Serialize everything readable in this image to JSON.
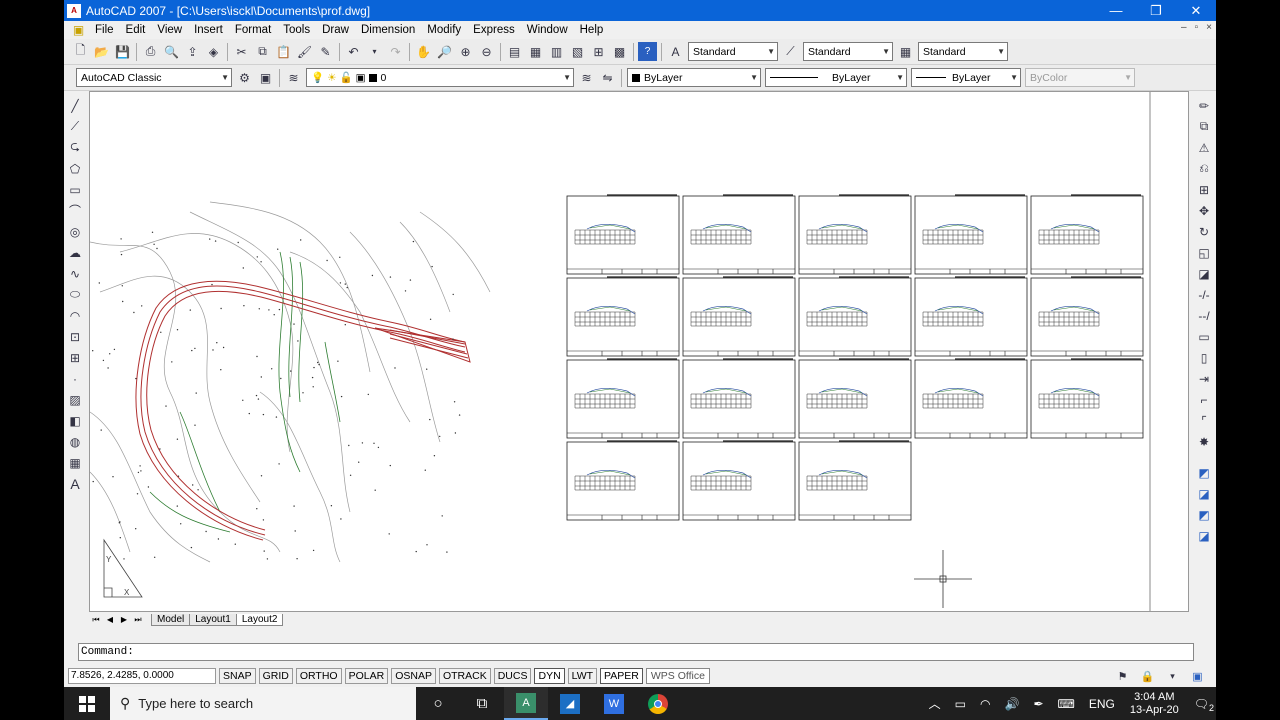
{
  "window": {
    "title": "AutoCAD 2007 - [C:\\Users\\isckl\\Documents\\prof.dwg]",
    "app_icon": "A",
    "minimize": "—",
    "restore": "❐",
    "close": "✕"
  },
  "menu": {
    "items": [
      "File",
      "Edit",
      "View",
      "Insert",
      "Format",
      "Tools",
      "Draw",
      "Dimension",
      "Modify",
      "Express",
      "Window",
      "Help"
    ],
    "doc_controls": [
      "–",
      "▫",
      "×"
    ]
  },
  "toolbar_styles": {
    "text_style": "Standard",
    "dim_style": "Standard",
    "table_style": "Standard"
  },
  "toolbar_layers": {
    "workspace": "AutoCAD Classic",
    "layer": "0",
    "color": "ByLayer",
    "linetype": "ByLayer",
    "lineweight": "ByLayer",
    "plotstyle": "ByColor"
  },
  "layout_tabs": {
    "nav": [
      "⏮",
      "◀",
      "▶",
      "⏭"
    ],
    "tabs": [
      "Model",
      "Layout1",
      "Layout2"
    ],
    "active": "Layout2"
  },
  "command": {
    "prompt": "Command:"
  },
  "status": {
    "coords": "7.8526, 2.4285, 0.0000",
    "buttons": [
      "SNAP",
      "GRID",
      "ORTHO",
      "POLAR",
      "OSNAP",
      "OTRACK",
      "DUCS",
      "DYN",
      "LWT",
      "PAPER"
    ],
    "on_buttons": [
      "DYN",
      "PAPER"
    ],
    "tooltip": "WPS Office"
  },
  "taskbar": {
    "search_placeholder": "Type here to search",
    "language": "ENG",
    "time": "3:04 AM",
    "date": "13-Apr-20",
    "notifications": "2"
  },
  "colors": {
    "titlebar": "#0a64d8",
    "road": "#b03030",
    "contour_green": "#2e7d32"
  },
  "sheets": {
    "rows": 4,
    "columns": 5,
    "count": 18
  }
}
